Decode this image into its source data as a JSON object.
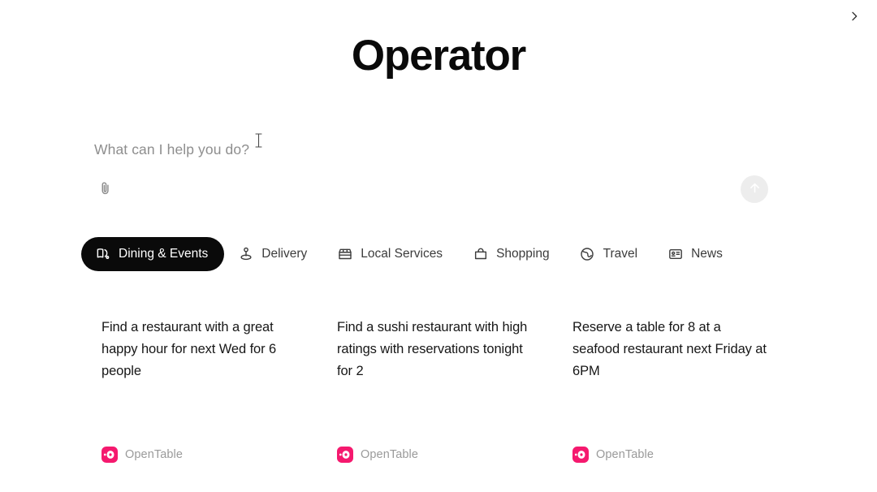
{
  "app": {
    "title": "Operator",
    "background_color": "#ffffff"
  },
  "composer": {
    "placeholder": "What can I help you do?",
    "value": "",
    "attach_icon": "paperclip-icon",
    "attach_label": "Attach file",
    "send_icon": "arrow-up-icon",
    "send_label": "Send",
    "send_enabled": false,
    "send_button_color": "#ededed",
    "cursor_icon": "text-ibeam-cursor"
  },
  "tabs": {
    "scroll_next_icon": "chevron-right-icon",
    "scroll_next_label": "Scroll categories right",
    "active_index": 0,
    "active_background": "#0a0a0a",
    "active_text_color": "#ffffff",
    "items": [
      {
        "label": "Dining & Events",
        "icon": "dining-napkin-icon",
        "active": true
      },
      {
        "label": "Delivery",
        "icon": "location-pin-person-icon",
        "active": false
      },
      {
        "label": "Local Services",
        "icon": "storefront-icon",
        "active": false
      },
      {
        "label": "Shopping",
        "icon": "shopping-bag-icon",
        "active": false
      },
      {
        "label": "Travel",
        "icon": "globe-icon",
        "active": false
      },
      {
        "label": "News",
        "icon": "news-card-icon",
        "active": false
      }
    ]
  },
  "suggestions": {
    "source_brand": "OpenTable",
    "source_logo_color": "#f5196e",
    "cards": [
      {
        "text": "Find a restaurant with a great happy hour for next Wed for 6 people",
        "source": "OpenTable",
        "source_icon": "opentable-logo-icon"
      },
      {
        "text": "Find a sushi restaurant with high ratings with reservations tonight for 2",
        "source": "OpenTable",
        "source_icon": "opentable-logo-icon"
      },
      {
        "text": "Reserve a table for 8 at a seafood restaurant next Friday at 6PM",
        "source": "OpenTable",
        "source_icon": "opentable-logo-icon"
      }
    ]
  }
}
